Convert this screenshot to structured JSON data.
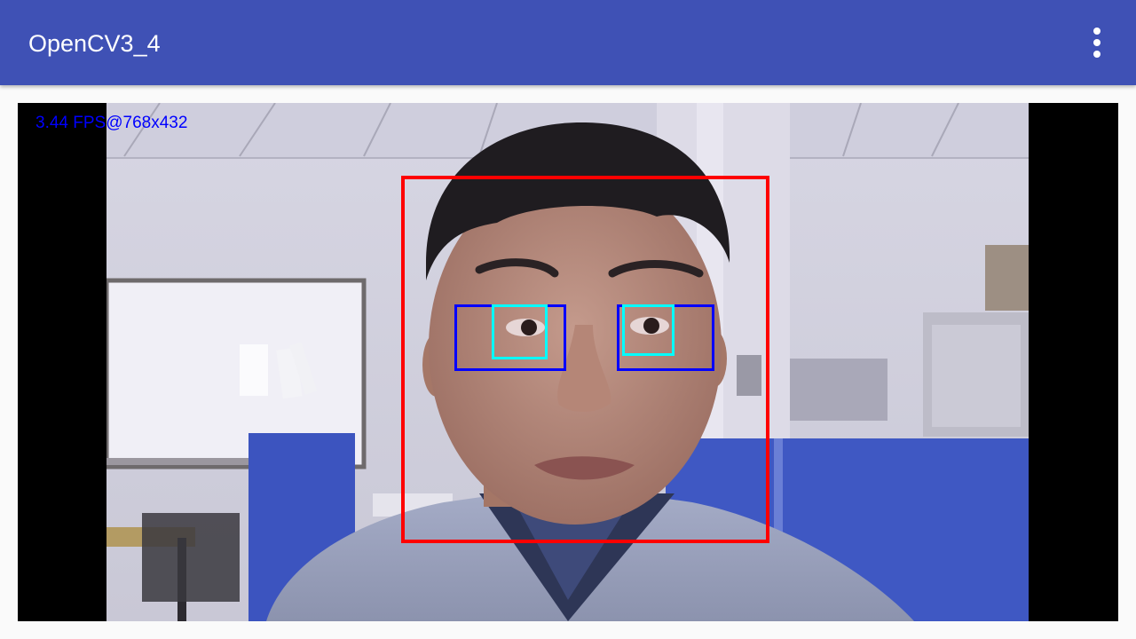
{
  "app": {
    "title": "OpenCV3_4"
  },
  "toolbar": {
    "overflow_icon": "more-vert-icon",
    "color": "#3f51b5"
  },
  "camera": {
    "fps_text": "3.44 FPS@768x432",
    "fps_color": "#0000ff"
  },
  "detections": {
    "face_color": "#ff0000",
    "eye_region_color": "#0000ff",
    "eye_color": "#00ffff"
  }
}
